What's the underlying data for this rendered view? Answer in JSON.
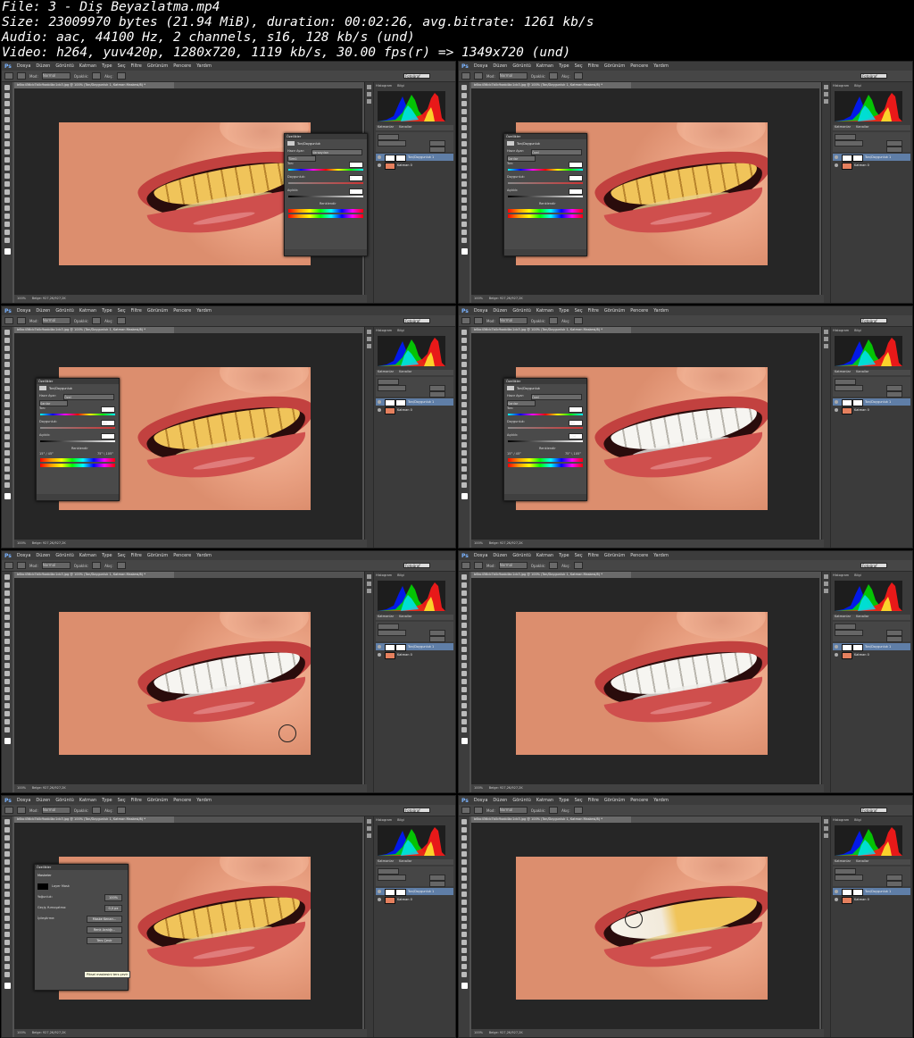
{
  "header": {
    "line1": "File: 3 - Diş Beyazlatma.mp4",
    "line2": "Size: 23009970 bytes (21.94 MiB), duration: 00:02:26, avg.bitrate: 1261 kb/s",
    "line3": "Audio: aac, 44100 Hz, 2 channels, s16, 128 kb/s (und)",
    "line4": "Video: h264, yuv420p, 1280x720, 1119 kb/s, 30.00 fps(r) => 1349x720 (und)"
  },
  "menu": [
    "Ps",
    "Dosya",
    "Düzen",
    "Görüntü",
    "Katman",
    "Type",
    "Seç",
    "Filtre",
    "Görünüm",
    "Pencere",
    "Yardım"
  ],
  "options": {
    "mode_label": "Mod:",
    "mode_value": "Normal",
    "opacity_label": "Opaklık:",
    "flow_label": "Akış:",
    "workspace": "Fotoğraf"
  },
  "document_tab": "b6bc456cb7b0c9aab4bc1cb3.jpg @ 100% (Ton/Doygunluk 1, Katman Maskesi/8) *",
  "status_zoom": "100%",
  "status_doc": "Belge: 927,2K/927,2K",
  "right_panel": {
    "tabs_top": [
      "Histogram",
      "Bilgi"
    ],
    "layers_tabs": [
      "Katmanlar",
      "Kanallar"
    ],
    "blend_mode": "Normal",
    "opacity": "Opaklık:",
    "opacity_value": "100%",
    "fill": "Dolgu:",
    "fill_value": "100%",
    "lock": "Kilitle:",
    "kind": "Tür",
    "layer_adjust": "Ton/Doygunluk 1",
    "layer_base": "Katman 0"
  },
  "properties": {
    "title": "Özellikler",
    "header": "Ton/Doygunluk",
    "preset_label": "Hazır Ayar:",
    "preset_values": [
      "Varsayılan",
      "Özel"
    ],
    "channel": "Tümü",
    "channel_yellow": "Sarılar",
    "hue": "Ton:",
    "saturation": "Doygunluk:",
    "lightness": "Açıklık:",
    "colorize": "Renklendir",
    "hue_val": "0",
    "sat_val_a": "0",
    "sat_val_b": "-80",
    "light_val_a": "0",
    "light_val_b": "+26",
    "range_a": "15° / 45°",
    "range_b": "75° \\ 105°"
  },
  "mask_panel": {
    "title": "Özellikler",
    "header": "Maskeler",
    "layer_mask": "Layer Mask",
    "density": "Yoğunluk:",
    "density_val": "100%",
    "feather": "Geçiş Yumuşatma:",
    "feather_val": "0,0 px",
    "refine": "İyileştirme:",
    "btn1": "Maske Kenarı...",
    "btn2": "Renk Aralığı...",
    "btn3": "Ters Çevir",
    "tooltip": "Piksel maskesini ters çevir"
  }
}
